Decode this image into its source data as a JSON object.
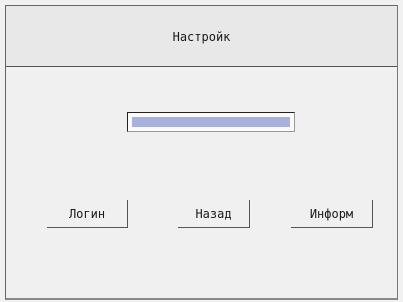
{
  "window": {
    "title": "Настройк"
  },
  "progress": {
    "value": 1.0
  },
  "buttons": {
    "login_label": "Логин",
    "back_label": "Назад",
    "info_label": "Информ"
  },
  "colors": {
    "background": "#f0f0f0",
    "title_bar": "#e8e8e8",
    "progress_fill": "#aab0dc",
    "border": "#555555"
  }
}
